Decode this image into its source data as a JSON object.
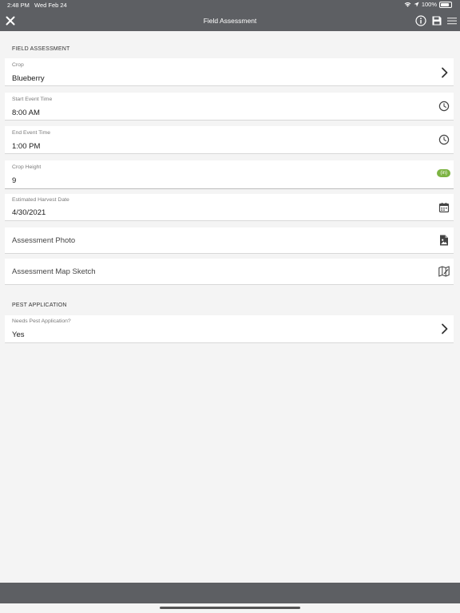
{
  "status_bar": {
    "time": "2:48 PM",
    "date": "Wed Feb 24",
    "battery": "100%"
  },
  "navbar": {
    "title": "Field Assessment"
  },
  "sections": {
    "field_assessment": "FIELD ASSESSMENT",
    "pest_application": "PEST APPLICATION"
  },
  "fields": {
    "crop": {
      "label": "Crop",
      "value": "Blueberry"
    },
    "start_time": {
      "label": "Start Event Time",
      "value": "8:00 AM"
    },
    "end_time": {
      "label": "End Event Time",
      "value": "1:00 PM"
    },
    "crop_height": {
      "label": "Crop Height",
      "value": "9",
      "unit": "(in)"
    },
    "harvest_date": {
      "label": "Estimated Harvest Date",
      "value": "4/30/2021"
    },
    "assessment_photo": {
      "label": "Assessment Photo"
    },
    "map_sketch": {
      "label": "Assessment Map Sketch"
    },
    "pest_application": {
      "label": "Needs Pest Application?",
      "value": "Yes"
    }
  },
  "colors": {
    "bar": "#5d5f63",
    "accent_green": "#7cb342",
    "background": "#f4f4f4"
  }
}
